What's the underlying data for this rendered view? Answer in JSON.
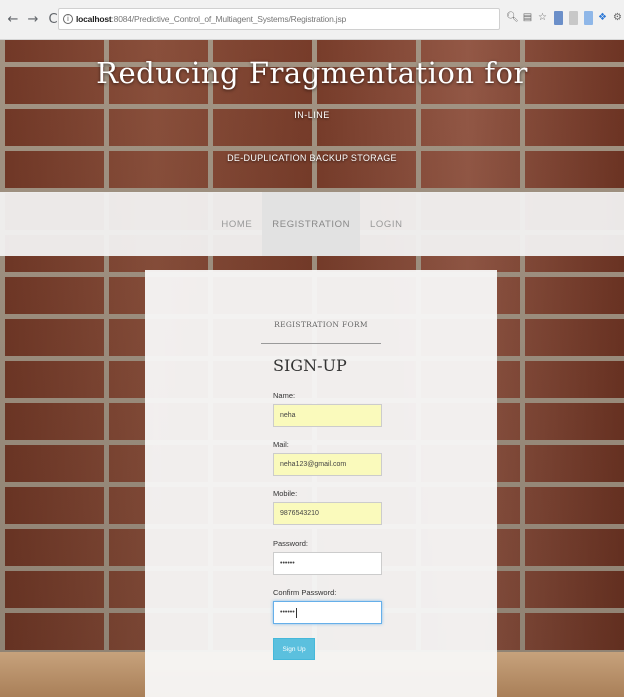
{
  "browser": {
    "back": "←",
    "forward": "→",
    "reload": "C",
    "url_host": "localhost",
    "url_path": ":8084/Predictive_Control_of_Multiagent_Systems/Registration.jsp"
  },
  "header": {
    "title": "Reducing Fragmentation for",
    "subtitle1": "IN-LINE",
    "subtitle2": "DE-DUPLICATION BACKUP STORAGE"
  },
  "nav": {
    "items": [
      {
        "label": "HOME"
      },
      {
        "label": "REGISTRATION"
      },
      {
        "label": "LOGIN"
      }
    ]
  },
  "form": {
    "caption": "REGISTRATION FORM",
    "heading": "SIGN-UP",
    "name_label": "Name:",
    "name_value": "neha",
    "mail_label": "Mail:",
    "mail_value": "neha123@gmail.com",
    "mobile_label": "Mobile:",
    "mobile_value": "9876543210",
    "password_label": "Password:",
    "password_value": "••••••",
    "confirm_label": "Confirm Password:",
    "confirm_value": "••••••",
    "submit_label": "Sign Up"
  },
  "colors": {
    "button": "#5bc0de",
    "autofill": "#fafabc"
  }
}
